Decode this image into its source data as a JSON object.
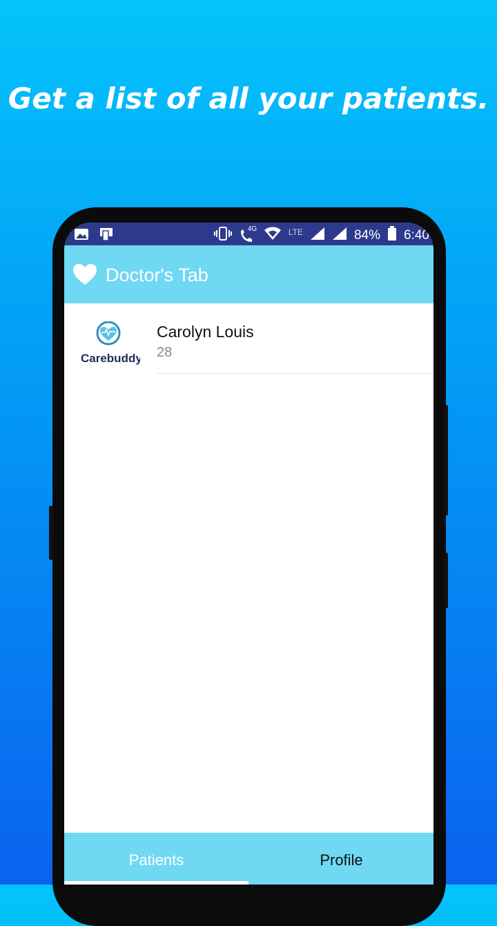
{
  "headline": "Get a list of all your patients.",
  "status_bar": {
    "signal_4g": "4G",
    "lte": "LTE",
    "battery": "84%",
    "time": "6:40"
  },
  "app_bar": {
    "title": "Doctor's Tab",
    "icon": "heart-icon"
  },
  "patients": [
    {
      "name": "Carolyn Louis",
      "age": "28",
      "avatar_text": "Carebuddy"
    }
  ],
  "bottom_nav": {
    "tabs": [
      {
        "label": "Patients",
        "selected": true
      },
      {
        "label": "Profile",
        "selected": false
      }
    ]
  },
  "colors": {
    "app_bar": "#6fd8f2",
    "status_bar": "#2d3a8c",
    "background_top": "#04c3fb",
    "background_bottom": "#0a63ee"
  }
}
